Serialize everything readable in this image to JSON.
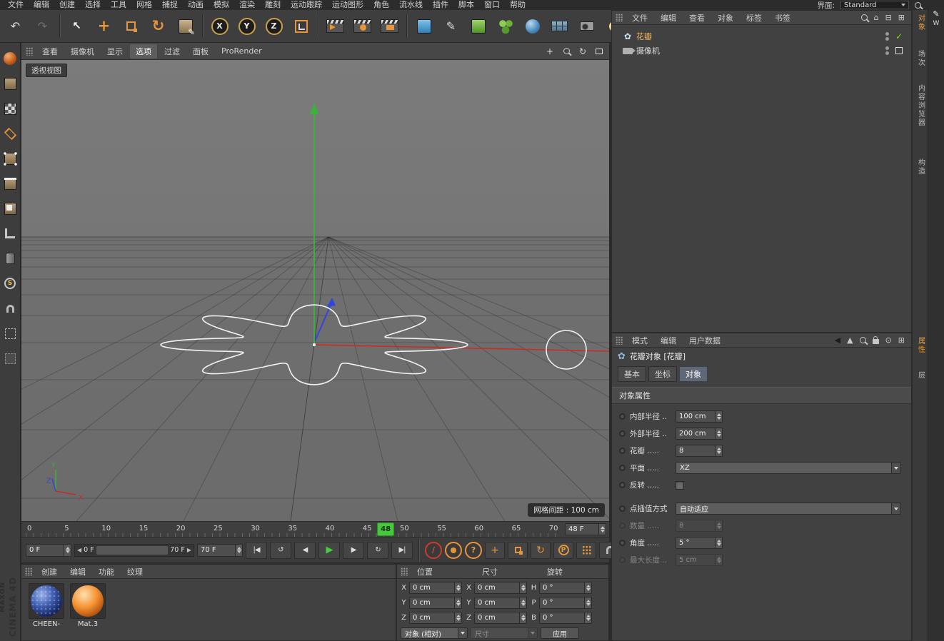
{
  "window": {
    "interface_label": "界面:",
    "interface_value": "Standard",
    "edge_label": "W"
  },
  "menubar": {
    "items": [
      "文件",
      "编辑",
      "创建",
      "选择",
      "工具",
      "网格",
      "捕捉",
      "动画",
      "模拟",
      "渲染",
      "雕刻",
      "运动跟踪",
      "运动图形",
      "角色",
      "流水线",
      "插件",
      "脚本",
      "窗口",
      "帮助"
    ]
  },
  "toolbar": {
    "x_label": "X",
    "y_label": "Y",
    "z_label": "Z"
  },
  "icons": {
    "undo_glyph": "↶",
    "redo_glyph": "↷",
    "selection_glyph": "↖",
    "move_glyph": "+",
    "rotate_glyph": "↻",
    "pen_glyph": "✎",
    "petal_glyph": "✿",
    "check_glyph": "✓",
    "home_glyph": "⌂",
    "collapse_glyph": "⊟",
    "expand_glyph": "⊞",
    "back_glyph": "◀",
    "up_glyph": "▲",
    "target_glyph": "⊙",
    "pan_glyph": "+",
    "s_label": "S"
  },
  "viewport": {
    "menu": [
      {
        "label": "查看"
      },
      {
        "label": "摄像机"
      },
      {
        "label": "显示"
      },
      {
        "label": "选项"
      },
      {
        "label": "过滤"
      },
      {
        "label": "面板"
      },
      {
        "label": "ProRender"
      }
    ],
    "active_menu": "选项",
    "view_label": "透视视图",
    "grid_info": "网格间距 : 100 cm",
    "axis_labels": {
      "x": "X",
      "y": "Y",
      "z": "Z"
    }
  },
  "timeline": {
    "ticks": [
      "0",
      "5",
      "10",
      "15",
      "20",
      "25",
      "30",
      "35",
      "40",
      "45",
      "50",
      "55",
      "60",
      "65",
      "70"
    ],
    "playhead_frame": "48",
    "frame_field": "48 F",
    "range_start": "0 F",
    "range_end": "70 F",
    "range_bar_start": "0 F",
    "range_bar_end": "70 F"
  },
  "transport": {
    "goto_start": "|◀",
    "prev_key": "↺",
    "prev_frame": "◀",
    "play": "▶",
    "next_frame": "▶",
    "next_key": "↻",
    "goto_end": "▶|",
    "record_glyph": "/",
    "question": "?",
    "parameter_label": "P",
    "left_arrow": "◀",
    "right_arrow": "▶"
  },
  "materials": {
    "menu": [
      "创建",
      "编辑",
      "功能",
      "纹理"
    ],
    "items": [
      {
        "name": "CHEEN-"
      },
      {
        "name": "Mat.3"
      }
    ]
  },
  "coordinates": {
    "headers": [
      "位置",
      "尺寸",
      "旋转"
    ],
    "position": [
      {
        "axis": "X",
        "value": "0 cm"
      },
      {
        "axis": "Y",
        "value": "0 cm"
      },
      {
        "axis": "Z",
        "value": "0 cm"
      }
    ],
    "size": [
      {
        "axis": "X",
        "value": "0 cm"
      },
      {
        "axis": "Y",
        "value": "0 cm"
      },
      {
        "axis": "Z",
        "value": "0 cm"
      }
    ],
    "rotation": [
      {
        "axis": "H",
        "value": "0 °"
      },
      {
        "axis": "P",
        "value": "0 °"
      },
      {
        "axis": "B",
        "value": "0 °"
      }
    ],
    "mode_dropdown": "对象 (相对)",
    "size_dropdown": "尺寸",
    "apply_label": "应用"
  },
  "object_manager": {
    "menu": [
      "文件",
      "编辑",
      "查看",
      "对象",
      "标签",
      "书签"
    ],
    "objects": [
      {
        "name": "花瓣",
        "selected": true
      },
      {
        "name": "摄像机",
        "selected": false
      }
    ]
  },
  "attribute_manager": {
    "menu": [
      "模式",
      "编辑",
      "用户数据"
    ],
    "title": "花瓣对象 [花瓣]",
    "tabs": [
      "基本",
      "坐标",
      "对象"
    ],
    "active_tab": "对象",
    "section": "对象属性",
    "rows": {
      "inner_radius": {
        "label": "内部半径 ..",
        "value": "100 cm"
      },
      "outer_radius": {
        "label": "外部半径 ..",
        "value": "200 cm"
      },
      "petals": {
        "label": "花瓣 .....",
        "value": "8"
      },
      "plane": {
        "label": "平面 .....",
        "value": "XZ"
      },
      "reverse": {
        "label": "反转 .....",
        "checked": false
      },
      "interpolation": {
        "label": "点插值方式",
        "value": "自动适应"
      },
      "number": {
        "label": "数量 .....",
        "value": "8",
        "disabled": true
      },
      "angle": {
        "label": "角度 .....",
        "value": "5 °"
      },
      "max_length": {
        "label": "最大长度 ..",
        "value": "5 cm",
        "disabled": true
      }
    }
  },
  "side_tabs": {
    "top": [
      {
        "label": "对象",
        "active": true
      },
      {
        "label": "场次",
        "active": false
      },
      {
        "label": "内容浏览器",
        "active": false
      },
      {
        "label": "构造",
        "active": false
      }
    ],
    "bottom": [
      {
        "label": "属性",
        "active": true
      },
      {
        "label": "层",
        "active": false
      }
    ]
  },
  "branding": {
    "app": "CINEMA 4D",
    "company": "MAXON"
  },
  "colors": {
    "accent_orange": "#e8953a",
    "green_axis": "#3bb33b",
    "red_axis": "#cc2a1f",
    "blue_axis": "#3344dd",
    "playhead_green": "#46c73c",
    "check_green": "#7ed321",
    "spline_white": "#f2f2f2"
  }
}
